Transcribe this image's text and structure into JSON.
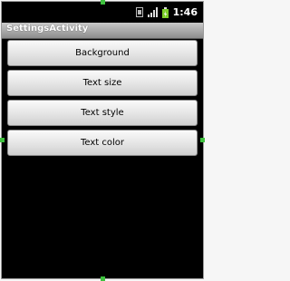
{
  "status_bar": {
    "time": "1:46",
    "icons": [
      "sim-icon",
      "signal-icon",
      "battery-icon"
    ]
  },
  "app_bar": {
    "title": "SettingsActivity"
  },
  "buttons": [
    {
      "label": "Background"
    },
    {
      "label": "Text size"
    },
    {
      "label": "Text style"
    },
    {
      "label": "Text color"
    }
  ],
  "colors": {
    "background": "#000000",
    "title_bar": "#aaaaaa",
    "selection_handle": "#3fc23f"
  }
}
